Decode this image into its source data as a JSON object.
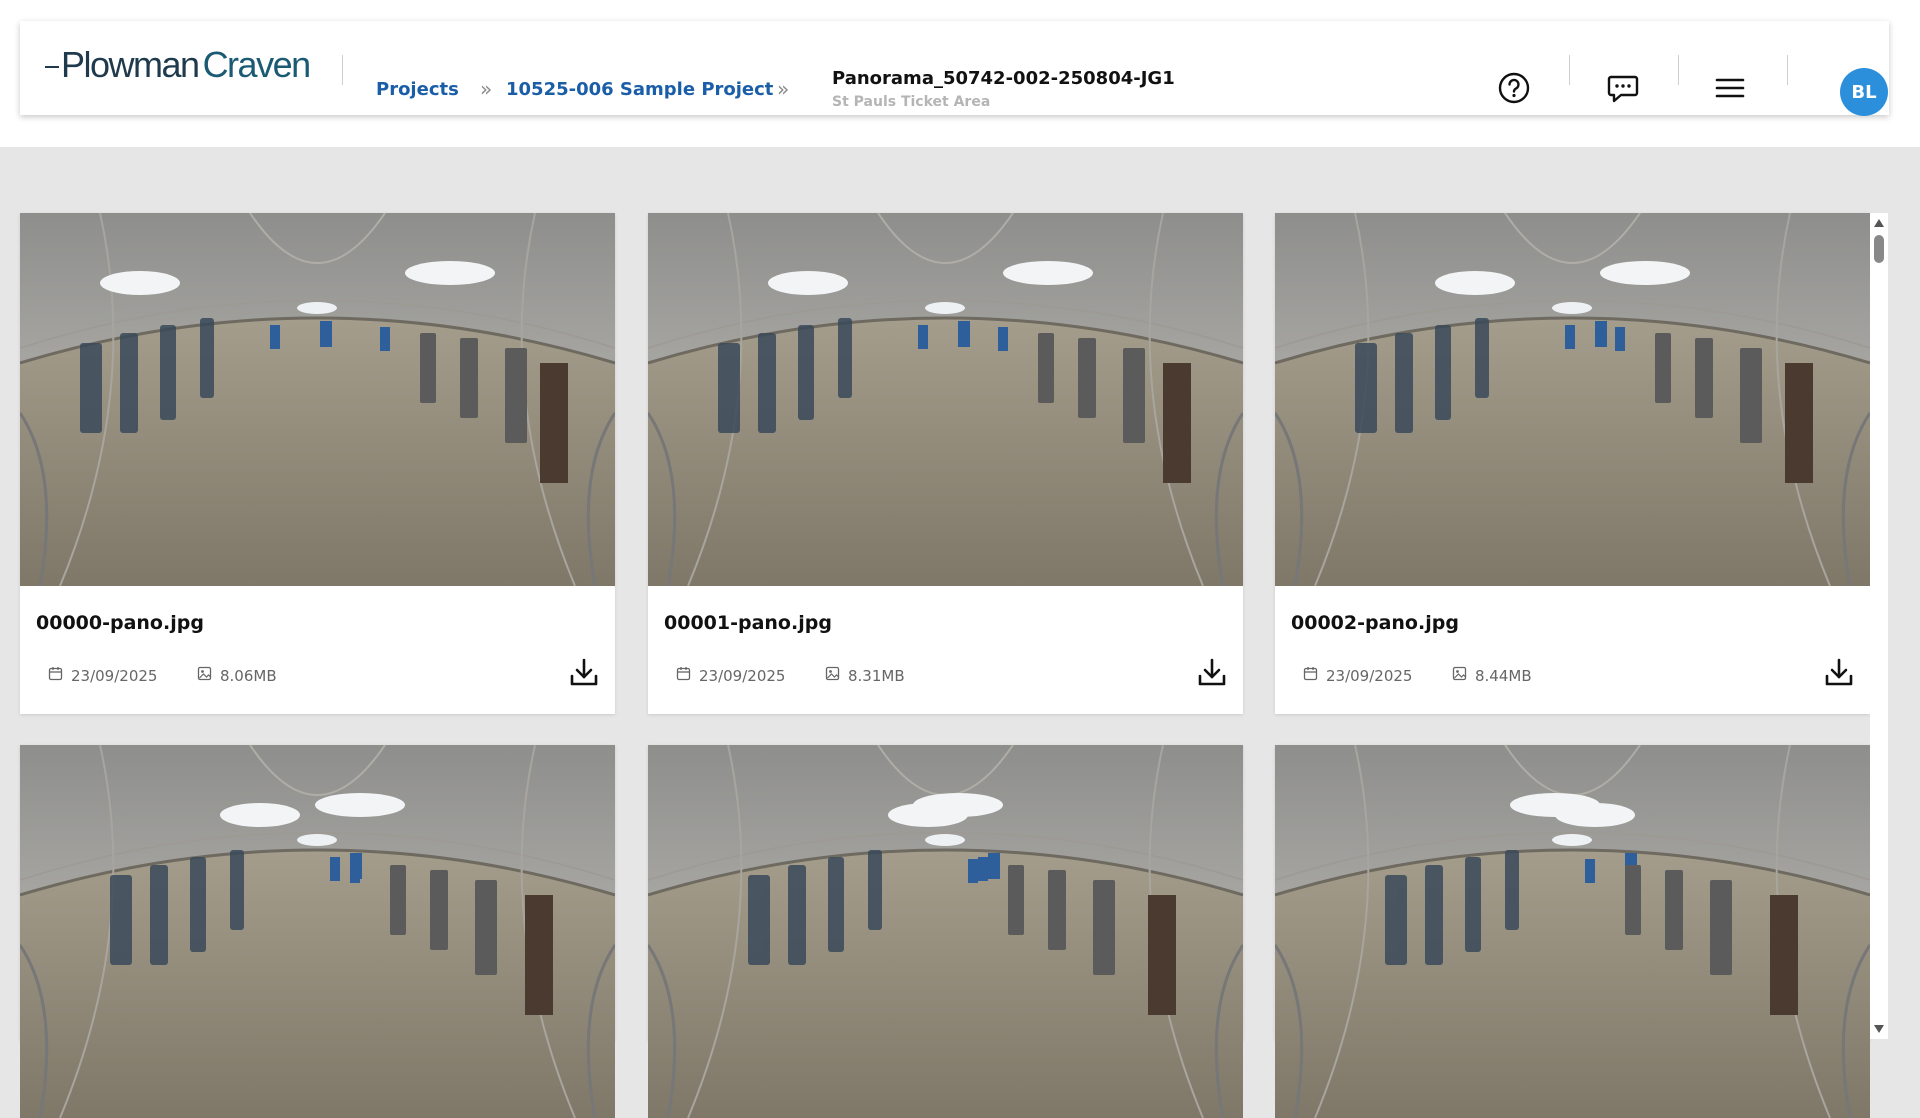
{
  "header": {
    "logo_part1": "Plowman",
    "logo_part2": "Craven",
    "breadcrumb": {
      "projects": "Projects",
      "project": "10525-006 Sample Project",
      "separator": "»"
    },
    "title": "Panorama_50742-002-250804-JG1",
    "subtitle": "St Pauls Ticket Area",
    "icons": [
      "help-icon",
      "chat-icon",
      "menu-icon"
    ],
    "avatar_initials": "BL"
  },
  "cards": [
    {
      "name": "00000-pano.jpg",
      "date": "23/09/2025",
      "size": "8.06MB"
    },
    {
      "name": "00001-pano.jpg",
      "date": "23/09/2025",
      "size": "8.31MB"
    },
    {
      "name": "00002-pano.jpg",
      "date": "23/09/2025",
      "size": "8.44MB"
    },
    {
      "name": "",
      "date": "",
      "size": ""
    },
    {
      "name": "",
      "date": "",
      "size": ""
    },
    {
      "name": "",
      "date": "",
      "size": ""
    }
  ],
  "colors": {
    "accent": "#1b5ea8",
    "avatar_bg": "#2c8fdc",
    "page_bg": "#e6e6e6"
  }
}
